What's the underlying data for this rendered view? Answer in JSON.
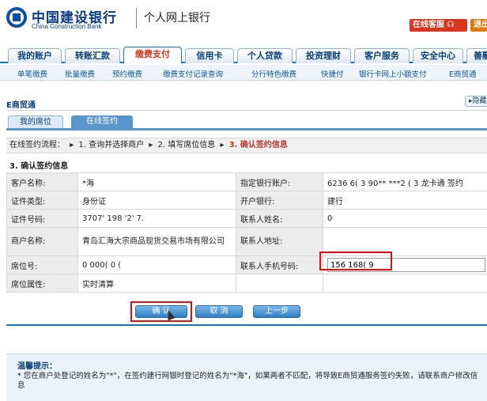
{
  "header": {
    "bank_name_cn": "中国建设银行",
    "bank_name_en": "China Construction Bank",
    "product": "个人网上银行",
    "service_btn": "在线客服",
    "exit_btn": "退出"
  },
  "nav": {
    "tabs": [
      "我的账户",
      "转账汇款",
      "缴费支付",
      "信用卡",
      "个人贷款",
      "投资理财",
      "客户服务",
      "安全中心",
      "善融"
    ],
    "active": "缴费支付"
  },
  "subnav": {
    "items": [
      "单笔缴费",
      "批量缴费",
      "预约缴费",
      "缴费支付记录查询",
      "分行特色缴费",
      "快捷付",
      "银行卡网上小额支付",
      "E商贸通"
    ]
  },
  "section": {
    "title": "E商贸通",
    "hide_label": "隐藏"
  },
  "inner_tabs": {
    "mine": "我的席位",
    "online": "在线签约"
  },
  "flow": {
    "prefix": "在线签约流程：",
    "step1": "1. 查询并选择商户",
    "step2": "2. 填写席位信息",
    "step3": "3. 确认签约信息"
  },
  "form": {
    "title": "3. 确认签约信息",
    "rows": [
      {
        "l1": "客户名称:",
        "v1": "*海",
        "l2": "指定银行账户:",
        "v2": "6236 6( 3 90** ***2 ( 3 龙卡通 签约"
      },
      {
        "l1": "证件类型:",
        "v1": "身份证",
        "l2": "开户银行:",
        "v2": "建行"
      },
      {
        "l1": "证件号码:",
        "v1": "3707' 198 '2' 7.",
        "l2": "联系人姓名:",
        "v2": "0"
      },
      {
        "l1": "商户名称:",
        "v1": "青岛汇海大宗商品现货交易市场有限公司",
        "l2": "联系人地址:",
        "v2": ""
      },
      {
        "l1": "席位号:",
        "v1": "0 000( 0 (",
        "l2": "联系人手机号码:",
        "v2": "156 168( 9"
      },
      {
        "l1": "席位属性:",
        "v1": "实时清算",
        "l2": "",
        "v2": ""
      }
    ]
  },
  "buttons": {
    "confirm": "确 认",
    "cancel": "取 消",
    "prev": "上一步"
  },
  "tips": {
    "title": "温馨提示：",
    "body": "* 您在商户处登记的姓名为\"*\"，在签约建行网银时登记的姓名为\"*海\"，如果两者不匹配，将导致E商贸通服务签约失败，请联系商户修改信息"
  }
}
